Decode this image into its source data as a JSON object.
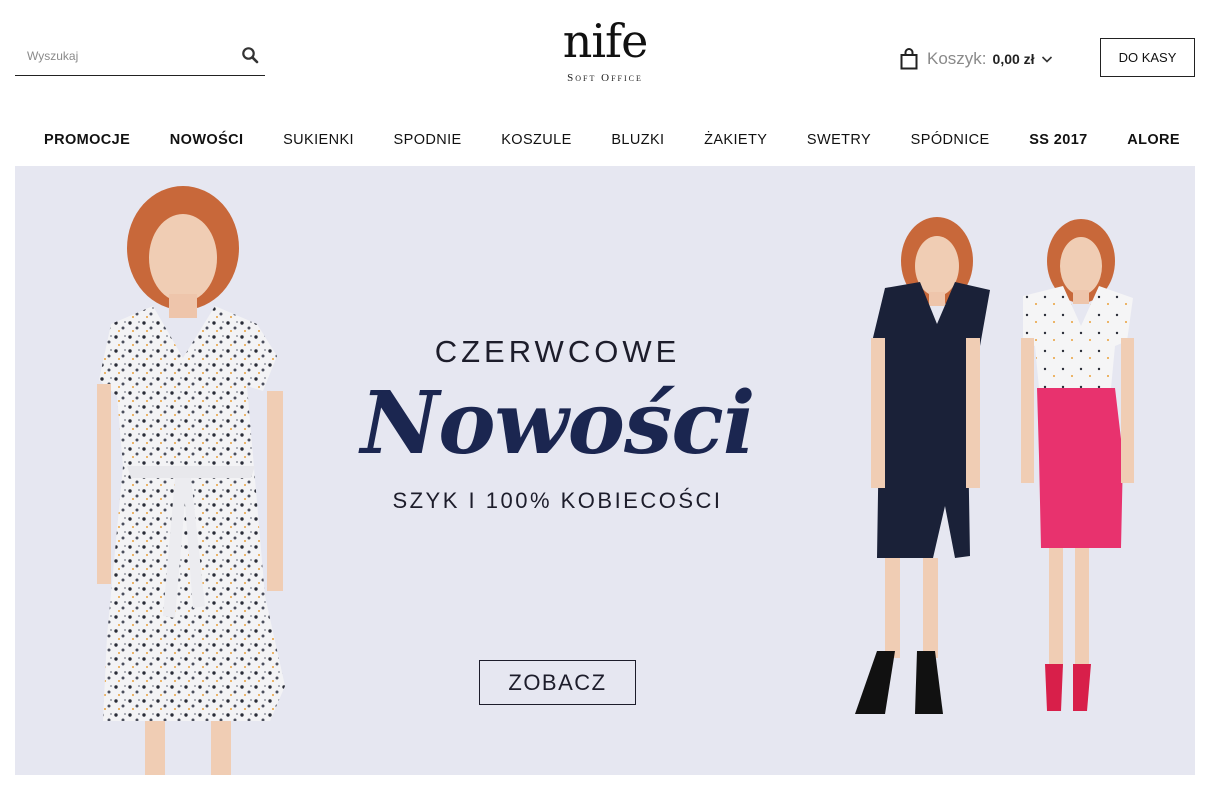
{
  "header": {
    "search": {
      "placeholder": "Wyszukaj",
      "value": "",
      "icon": "search-icon"
    },
    "logo": {
      "brand": "nife",
      "tagline": "Soft Office"
    },
    "cart": {
      "label": "Koszyk:",
      "total": "0,00 zł",
      "icon": "shopping-bag-icon"
    },
    "checkout_label": "DO KASY"
  },
  "nav": {
    "items": [
      {
        "label": "PROMOCJE"
      },
      {
        "label": "NOWOŚCI"
      },
      {
        "label": "SUKIENKI"
      },
      {
        "label": "SPODNIE"
      },
      {
        "label": "KOSZULE"
      },
      {
        "label": "BLUZKI"
      },
      {
        "label": "ŻAKIETY"
      },
      {
        "label": "SWETRY"
      },
      {
        "label": "SPÓDNICE"
      },
      {
        "label": "SS 2017"
      },
      {
        "label": "ALORE"
      }
    ]
  },
  "banner": {
    "kicker": "CZERWCOWE",
    "headline": "Nowości",
    "subline": "SZYK I 100% KOBIECOŚCI",
    "cta": "ZOBACZ",
    "colors": {
      "background": "#e6e7f1",
      "headline": "#1b2650",
      "dress_navy": "#1a2138",
      "skirt_pink": "#e8326e"
    }
  }
}
